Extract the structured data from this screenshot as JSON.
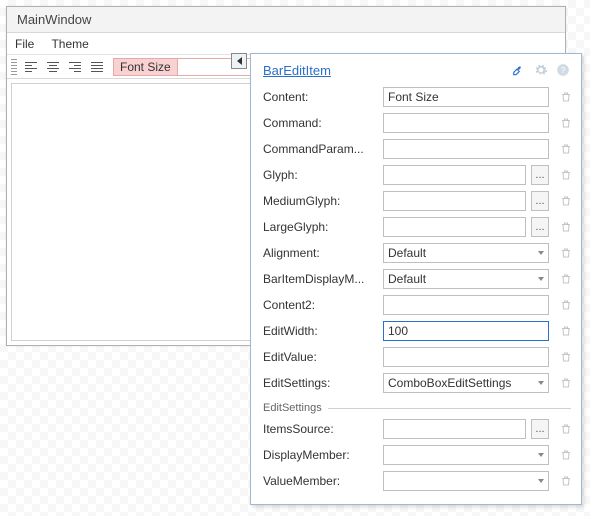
{
  "window": {
    "title": "MainWindow",
    "menus": {
      "file": "File",
      "theme": "Theme"
    }
  },
  "toolbar": {
    "fontSizeLabel": "Font Size",
    "fontSizeValue": ""
  },
  "popup": {
    "title": "BarEditItem",
    "groupLabel": "EditSettings",
    "rows": {
      "content": {
        "label": "Content:",
        "value": "Font Size",
        "kind": "text"
      },
      "command": {
        "label": "Command:",
        "value": "",
        "kind": "text"
      },
      "commandParam": {
        "label": "CommandParam...",
        "value": "",
        "kind": "text"
      },
      "glyph": {
        "label": "Glyph:",
        "value": "",
        "kind": "browse"
      },
      "mediumGlyph": {
        "label": "MediumGlyph:",
        "value": "",
        "kind": "browse"
      },
      "largeGlyph": {
        "label": "LargeGlyph:",
        "value": "",
        "kind": "browse"
      },
      "alignment": {
        "label": "Alignment:",
        "value": "Default",
        "kind": "dropdown"
      },
      "barItemDisplay": {
        "label": "BarItemDisplayM...",
        "value": "Default",
        "kind": "dropdown"
      },
      "content2": {
        "label": "Content2:",
        "value": "",
        "kind": "text"
      },
      "editWidth": {
        "label": "EditWidth:",
        "value": "100",
        "kind": "text",
        "focused": true
      },
      "editValue": {
        "label": "EditValue:",
        "value": "",
        "kind": "text"
      },
      "editSettings": {
        "label": "EditSettings:",
        "value": "ComboBoxEditSettings",
        "kind": "dropdown"
      },
      "itemsSource": {
        "label": "ItemsSource:",
        "value": "",
        "kind": "browse"
      },
      "displayMember": {
        "label": "DisplayMember:",
        "value": "",
        "kind": "dropdown"
      },
      "valueMember": {
        "label": "ValueMember:",
        "value": "",
        "kind": "dropdown"
      }
    }
  }
}
